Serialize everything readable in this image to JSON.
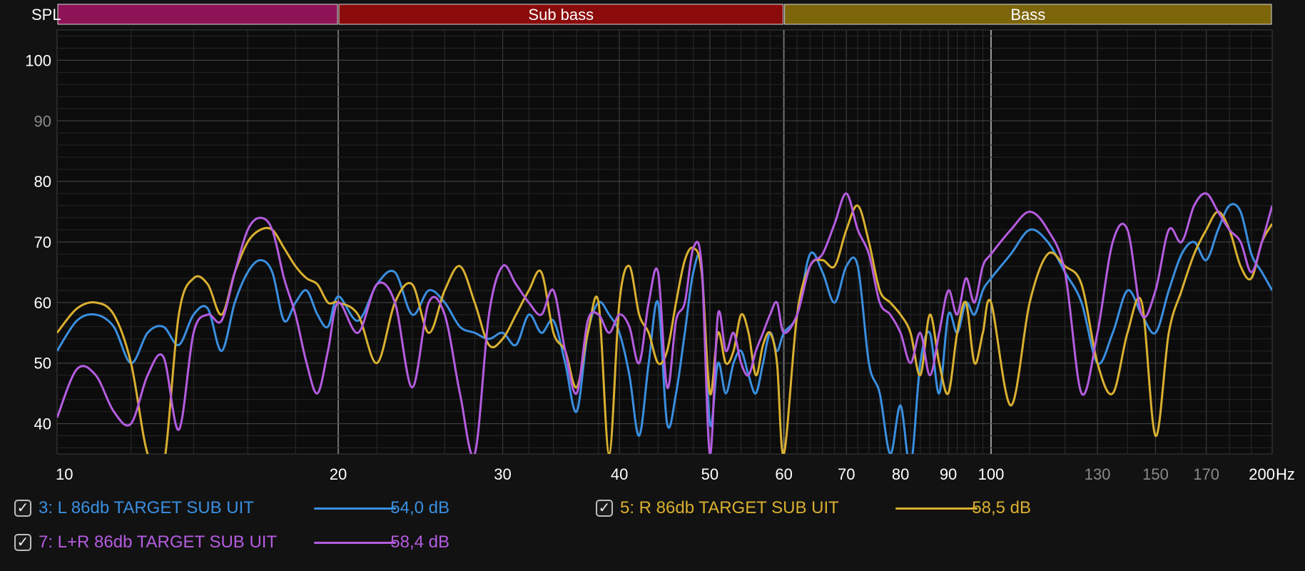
{
  "chart_data": {
    "type": "line",
    "ylabel": "SPL",
    "xunit": "Hz",
    "xscale": "log",
    "xlim": [
      10,
      200
    ],
    "ylim": [
      35,
      105
    ],
    "grid": true,
    "yticks": [
      40,
      50,
      60,
      70,
      80,
      90,
      100
    ],
    "xticks": [
      {
        "v": 10,
        "label": "10",
        "dim": false
      },
      {
        "v": 20,
        "label": "20",
        "dim": false
      },
      {
        "v": 30,
        "label": "30",
        "dim": false
      },
      {
        "v": 40,
        "label": "40",
        "dim": false
      },
      {
        "v": 50,
        "label": "50",
        "dim": false
      },
      {
        "v": 60,
        "label": "60",
        "dim": false
      },
      {
        "v": 70,
        "label": "70",
        "dim": false
      },
      {
        "v": 80,
        "label": "80",
        "dim": false
      },
      {
        "v": 90,
        "label": "90",
        "dim": false
      },
      {
        "v": 100,
        "label": "100",
        "dim": false
      },
      {
        "v": 130,
        "label": "130",
        "dim": true
      },
      {
        "v": 150,
        "label": "150",
        "dim": true
      },
      {
        "v": 170,
        "label": "170",
        "dim": true
      },
      {
        "v": 200,
        "label": "200",
        "dim": false
      }
    ],
    "bands": [
      {
        "label": "",
        "from": 10,
        "to": 20,
        "color": "#8e1356"
      },
      {
        "label": "Sub bass",
        "from": 20,
        "to": 60,
        "color": "#8b0a0a"
      },
      {
        "label": "Bass",
        "from": 60,
        "to": 200,
        "color": "#7d650a"
      }
    ],
    "series": [
      {
        "name": "3: L 86db TARGET SUB UIT",
        "color": "#3a8fe0",
        "value": "54,0 dB",
        "checked": true,
        "x": [
          10,
          10.5,
          11,
          11.5,
          12,
          12.5,
          13,
          13.5,
          14,
          14.5,
          15,
          15.5,
          16,
          16.5,
          17,
          17.5,
          18,
          18.5,
          19,
          19.5,
          20,
          21,
          22,
          23,
          24,
          25,
          26,
          27,
          28,
          29,
          30,
          31,
          32,
          33,
          34,
          35,
          36,
          37,
          38,
          39,
          40,
          41,
          42,
          43,
          44,
          45,
          46,
          47,
          48,
          49,
          50,
          51,
          52,
          53,
          54,
          55,
          56,
          57,
          58,
          59,
          60,
          62,
          64,
          66,
          68,
          70,
          72,
          74,
          76,
          78,
          80,
          82,
          84,
          86,
          88,
          90,
          92,
          94,
          96,
          98,
          100,
          105,
          110,
          115,
          120,
          125,
          130,
          135,
          140,
          145,
          150,
          155,
          160,
          165,
          170,
          175,
          180,
          185,
          190,
          195,
          200
        ],
        "y": [
          52,
          57,
          58,
          56,
          50,
          55,
          56,
          53,
          58,
          59,
          52,
          60,
          65,
          67,
          65,
          57,
          60,
          62,
          58,
          56,
          61,
          57,
          63,
          65,
          58,
          62,
          60,
          56,
          55,
          54,
          55,
          53,
          58,
          55,
          57,
          50,
          42,
          55,
          60,
          58,
          55,
          48,
          38,
          50,
          60,
          40,
          45,
          55,
          65,
          66,
          40,
          50,
          45,
          50,
          52,
          48,
          45,
          50,
          55,
          52,
          55,
          58,
          68,
          65,
          60,
          66,
          66,
          50,
          45,
          35,
          43,
          33,
          50,
          55,
          45,
          58,
          55,
          60,
          58,
          62,
          64,
          68,
          72,
          70,
          65,
          60,
          50,
          55,
          62,
          58,
          55,
          62,
          68,
          70,
          67,
          72,
          76,
          75,
          68,
          65,
          62
        ]
      },
      {
        "name": "5: R 86db TARGET SUB UIT",
        "color": "#d9b030",
        "value": "58,5 dB",
        "checked": true,
        "x": [
          10,
          10.5,
          11,
          11.5,
          12,
          12.5,
          13,
          13.5,
          14,
          14.5,
          15,
          15.5,
          16,
          16.5,
          17,
          17.5,
          18,
          18.5,
          19,
          19.5,
          20,
          21,
          22,
          23,
          24,
          25,
          26,
          27,
          28,
          29,
          30,
          31,
          32,
          33,
          34,
          35,
          36,
          37,
          38,
          39,
          40,
          41,
          42,
          43,
          44,
          45,
          46,
          47,
          48,
          49,
          50,
          51,
          52,
          53,
          54,
          55,
          56,
          57,
          58,
          59,
          60,
          62,
          64,
          66,
          68,
          70,
          72,
          74,
          76,
          78,
          80,
          82,
          84,
          86,
          88,
          90,
          92,
          94,
          96,
          98,
          100,
          105,
          110,
          115,
          120,
          125,
          130,
          135,
          140,
          145,
          150,
          155,
          160,
          165,
          170,
          175,
          180,
          185,
          190,
          195,
          200
        ],
        "y": [
          55,
          59,
          60,
          58,
          50,
          35,
          33,
          58,
          64,
          63,
          58,
          65,
          70,
          72,
          72,
          69,
          66,
          64,
          63,
          60,
          60,
          58,
          50,
          60,
          63,
          55,
          62,
          66,
          60,
          53,
          54,
          58,
          62,
          65,
          55,
          52,
          46,
          55,
          60,
          35,
          60,
          66,
          58,
          55,
          50,
          52,
          60,
          67,
          69,
          65,
          45,
          55,
          50,
          52,
          58,
          55,
          48,
          53,
          55,
          50,
          35,
          58,
          66,
          67,
          66,
          72,
          76,
          70,
          62,
          60,
          58,
          55,
          48,
          58,
          50,
          45,
          55,
          60,
          50,
          55,
          60,
          43,
          60,
          68,
          66,
          63,
          50,
          45,
          55,
          60,
          38,
          55,
          62,
          68,
          72,
          75,
          72,
          66,
          64,
          70,
          73
        ]
      },
      {
        "name": "7: L+R 86db TARGET SUB UIT",
        "color": "#b55ce0",
        "value": "58,4 dB",
        "checked": true,
        "x": [
          10,
          10.5,
          11,
          11.5,
          12,
          12.5,
          13,
          13.5,
          14,
          14.5,
          15,
          15.5,
          16,
          16.5,
          17,
          17.5,
          18,
          18.5,
          19,
          19.5,
          20,
          21,
          22,
          23,
          24,
          25,
          26,
          27,
          28,
          29,
          30,
          31,
          32,
          33,
          34,
          35,
          36,
          37,
          38,
          39,
          40,
          41,
          42,
          43,
          44,
          45,
          46,
          47,
          48,
          49,
          50,
          51,
          52,
          53,
          54,
          55,
          56,
          57,
          58,
          59,
          60,
          62,
          64,
          66,
          68,
          70,
          72,
          74,
          76,
          78,
          80,
          82,
          84,
          86,
          88,
          90,
          92,
          94,
          96,
          98,
          100,
          105,
          110,
          115,
          120,
          125,
          130,
          135,
          140,
          145,
          150,
          155,
          160,
          165,
          170,
          175,
          180,
          185,
          190,
          195,
          200
        ],
        "y": [
          41,
          49,
          48,
          42,
          40,
          48,
          51,
          39,
          55,
          58,
          57,
          65,
          72,
          74,
          72,
          64,
          58,
          50,
          45,
          52,
          60,
          55,
          63,
          60,
          46,
          60,
          58,
          45,
          35,
          58,
          66,
          63,
          60,
          58,
          62,
          52,
          45,
          57,
          58,
          55,
          58,
          56,
          50,
          60,
          65,
          46,
          57,
          60,
          69,
          66,
          35,
          58,
          52,
          55,
          50,
          48,
          52,
          55,
          58,
          60,
          55,
          58,
          66,
          68,
          73,
          78,
          72,
          68,
          60,
          58,
          55,
          50,
          55,
          48,
          55,
          62,
          58,
          64,
          60,
          66,
          68,
          72,
          75,
          72,
          65,
          45,
          55,
          70,
          72,
          58,
          62,
          72,
          70,
          76,
          78,
          75,
          72,
          70,
          65,
          70,
          76
        ]
      }
    ]
  }
}
